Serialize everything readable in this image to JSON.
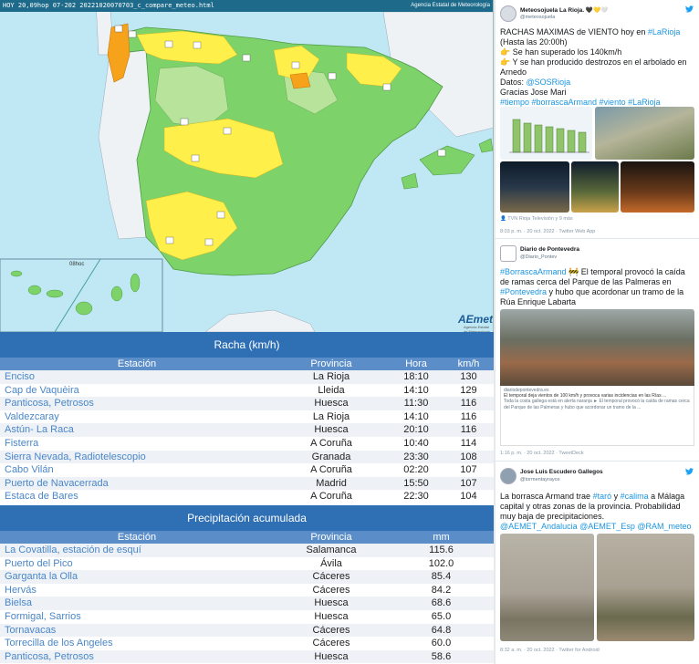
{
  "map": {
    "banner_left": "HOY 20,09hop",
    "banner_code": "07-202 20221020070703_c_compare_meteo.html",
    "banner_right": "Agencia Estatal de Meteorología",
    "canary_label": "08hoc",
    "logo": "AEmet",
    "logo_sub": "Agencia Estatal de Meteorología",
    "colors": {
      "sea": "#bfe8f4",
      "green": "#7dd36a",
      "light_green": "#b7e39a",
      "yellow": "#ffef4a",
      "orange": "#f6a21a",
      "land_abroad": "#eef2f4"
    }
  },
  "racha": {
    "title": "Racha (km/h)",
    "headers": [
      "Estación",
      "Provincia",
      "Hora",
      "km/h"
    ],
    "rows": [
      [
        "Enciso",
        "La Rioja",
        "18:10",
        "130"
      ],
      [
        "Cap de Vaquèira",
        "Lleida",
        "14:10",
        "129"
      ],
      [
        "Panticosa, Petrosos",
        "Huesca",
        "11:30",
        "116"
      ],
      [
        "Valdezcaray",
        "La Rioja",
        "14:10",
        "116"
      ],
      [
        "Astún- La Raca",
        "Huesca",
        "20:10",
        "116"
      ],
      [
        "Fisterra",
        "A Coruña",
        "10:40",
        "114"
      ],
      [
        "Sierra Nevada, Radiotelescopio",
        "Granada",
        "23:30",
        "108"
      ],
      [
        "Cabo Vilán",
        "A Coruña",
        "02:20",
        "107"
      ],
      [
        "Puerto de Navacerrada",
        "Madrid",
        "15:50",
        "107"
      ],
      [
        "Estaca de Bares",
        "A Coruña",
        "22:30",
        "104"
      ]
    ]
  },
  "precip": {
    "title": "Precipitación acumulada",
    "headers": [
      "Estación",
      "Provincia",
      "mm"
    ],
    "rows": [
      [
        "La Covatilla, estación de esquí",
        "Salamanca",
        "115.6"
      ],
      [
        "Puerto del Pico",
        "Ávila",
        "102.0"
      ],
      [
        "Garganta la Olla",
        "Cáceres",
        "85.4"
      ],
      [
        "Hervás",
        "Cáceres",
        "84.2"
      ],
      [
        "Bielsa",
        "Huesca",
        "68.6"
      ],
      [
        "Formigal, Sarrios",
        "Huesca",
        "65.0"
      ],
      [
        "Tornavacas",
        "Cáceres",
        "64.8"
      ],
      [
        "Torrecilla de los Angeles",
        "Cáceres",
        "60.0"
      ],
      [
        "Panticosa, Petrosos",
        "Huesca",
        "58.6"
      ]
    ]
  },
  "tweets": [
    {
      "name": "Meteosojuela La Rioja. 🖤💛🤍",
      "handle": "@meteosojuela",
      "lines": [
        {
          "text": "RACHAS MAXIMAS de VIENTO hoy en ",
          "tag": "#LaRioja"
        },
        {
          "text": "(Hasta las 20:00h)"
        },
        {
          "text": "👉 Se han superado los 140km/h"
        },
        {
          "text": "👉 Y se han producido destrozos en el arbolado en Arnedo"
        },
        {
          "text": "Datos: ",
          "tag": "@SOSRioja"
        },
        {
          "text": "Gracias Jose Mari"
        },
        {
          "text": "",
          "tag": "#tiempo #borrascaArmand #viento #LaRioja"
        }
      ],
      "credit": "TVN Rioja Televisión y 9 más",
      "meta": "8:03 p. m. · 20 oct. 2022 · Twitter Web App"
    },
    {
      "name": "Diario de Pontevedra",
      "handle": "@Diario_Pontev",
      "lines": [
        {
          "tag": "#BorrascaArmand",
          "text": " 🚧 El temporal provocó la caída de ramas cerca del Parque de las Palmeras en "
        },
        {
          "tag": "#Pontevedra",
          "text": " y hubo que acordonar un tramo de la Rúa Enrique Labarta"
        }
      ],
      "card_domain": "diariodepontevedra.es",
      "card_title": "El temporal deja vientos de 100 km/h y provoca varias incidencias en las Rías ...",
      "card_desc": "Toda la costa gallega está en alerta naranja ► El temporal provocó la caída de ramas cerca del Parque de las Palmeras y hubo que acordonar un tramo de la ...",
      "meta": "1:16 p. m. · 20 oct. 2022 · TweetDeck"
    },
    {
      "name": "Jose Luis Escudero Gallegos",
      "handle": "@tormentayrayos",
      "body_a": "La borrasca Armand trae ",
      "tag_a": "#taró",
      "body_b": " y ",
      "tag_b": "#calima",
      "body_c": " a Málaga capital y otras zonas de la provincia. Probabilidad muy baja de precipitaciones.",
      "mentions": "@AEMET_Andalucia @AEMET_Esp @RAM_meteo",
      "meta": "8:32 a. m. · 20 oct. 2022 · Twitter for Android"
    }
  ]
}
